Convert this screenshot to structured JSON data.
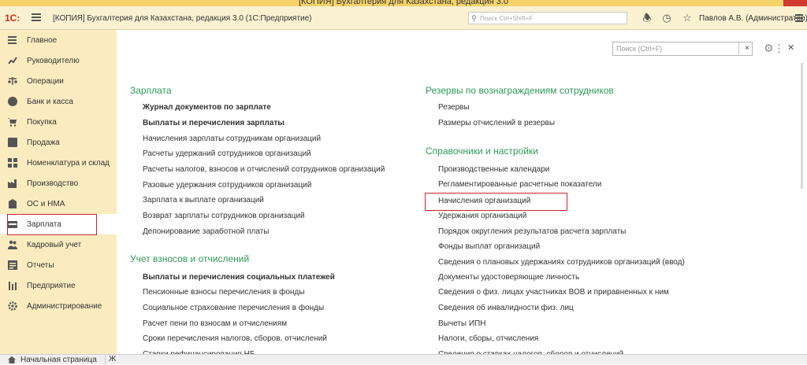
{
  "window_title": "[КОПИЯ] Бухгалтерия для Казахстана, редакция 3.0",
  "header": {
    "logo": "1С:",
    "title": "[КОПИЯ] Бухгалтерия для Казахстана, редакция 3.0  (1С:Предприятие)",
    "search_placeholder": "Поиск Ctrl+Shift+F",
    "user": "Павлов А.В. (Администратор)",
    "icons": [
      "bell-icon",
      "history-icon",
      "star-icon"
    ]
  },
  "sidebar": {
    "items": [
      {
        "label": "Главное",
        "icon": "menu-lines-icon"
      },
      {
        "label": "Руководителю",
        "icon": "trend-chart-icon"
      },
      {
        "label": "Операции",
        "icon": "scales-icon"
      },
      {
        "label": "Банк и касса",
        "icon": "coin-icon"
      },
      {
        "label": "Покупка",
        "icon": "cart-icon"
      },
      {
        "label": "Продажа",
        "icon": "bag-icon"
      },
      {
        "label": "Номенклатура и склад",
        "icon": "boxes-icon"
      },
      {
        "label": "Производство",
        "icon": "factory-icon"
      },
      {
        "label": "ОС и НМА",
        "icon": "building-icon"
      },
      {
        "label": "Зарплата",
        "icon": "wallet-icon"
      },
      {
        "label": "Кадровый учет",
        "icon": "people-icon"
      },
      {
        "label": "Отчеты",
        "icon": "report-icon"
      },
      {
        "label": "Предприятие",
        "icon": "enterprise-icon"
      },
      {
        "label": "Администрирование",
        "icon": "gear-icon"
      }
    ],
    "active_index": 9
  },
  "content": {
    "search_placeholder": "Поиск (Ctrl+F)",
    "left": {
      "salary": {
        "title": "Зарплата",
        "links": [
          "Журнал документов по зарплате",
          "Выплаты и перечисления зарплаты",
          "Начисления зарплаты сотрудникам организаций",
          "Расчеты удержаний сотрудников организаций",
          "Расчеты налогов, взносов и отчислений сотрудников организаций",
          "Разовые удержания сотрудников организаций",
          "Зарплата к выплате организаций",
          "Возврат зарплаты сотрудников организаций",
          "Депонирование заработной платы"
        ]
      },
      "contrib": {
        "title": "Учет взносов и отчислений",
        "links": [
          "Выплаты и перечисления социальных платежей",
          "Пенсионные взносы перечисления в фонды",
          "Социальное страхование перечисления в фонды",
          "Расчет пени по взносам и отчислениям",
          "Сроки перечисления налогов, сборов, отчислений",
          "Ставки рефинансирования НБ"
        ]
      }
    },
    "right": {
      "reserves": {
        "title": "Резервы по вознаграждениям сотрудников",
        "links": [
          "Резервы",
          "Размеры отчислений в резервы"
        ]
      },
      "refs": {
        "title": "Справочники и настройки",
        "links": [
          "Производственные календари",
          "Регламентированные расчетные показатели",
          "Начисления организаций",
          "Удержания организаций",
          "Порядок округления результатов расчета зарплаты",
          "Фонды выплат организаций",
          "Сведения о плановых удержаниях сотрудников организаций (ввод)",
          "Документы удостоверяющие личность",
          "Сведения о физ. лицах участниках ВОВ и приравненных к ним",
          "Сведения об инвалидности физ. лиц",
          "Вычеты ИПН",
          "Налоги, сборы, отчисления",
          "Сведения о ставках налогов, сборов и отчислений"
        ],
        "highlighted_index": 2
      }
    }
  },
  "bottom": {
    "home_tab": "Начальная страница",
    "next_tab": "Ж"
  }
}
